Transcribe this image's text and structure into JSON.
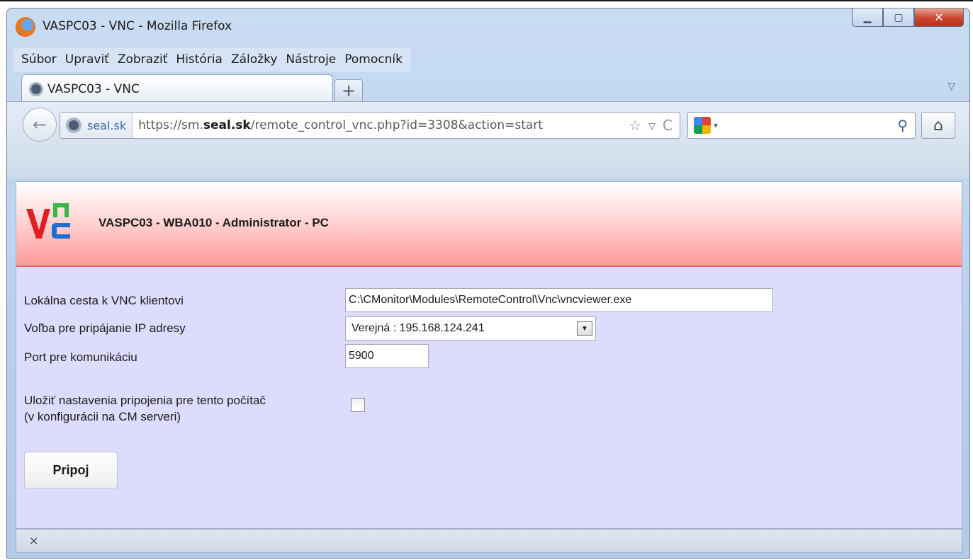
{
  "window": {
    "title": "VASPC03 - VNC - Mozilla Firefox",
    "minimize_glyph": "▁",
    "maximize_glyph": "▢",
    "close_glyph": "✕"
  },
  "menu": [
    "Súbor",
    "Upraviť",
    "Zobraziť",
    "História",
    "Záložky",
    "Nástroje",
    "Pomocník"
  ],
  "tab": {
    "label": "VASPC03 - VNC",
    "new_tab_glyph": "+",
    "list_glyph": "▽"
  },
  "navbar": {
    "back_glyph": "←",
    "site_identity": "seal.sk",
    "url_prefix": "https://sm.",
    "url_domain": "seal.sk",
    "url_suffix": "/remote_control_vnc.php?id=3308&action=start",
    "star_glyph": "☆",
    "dropdown_glyph": "▿",
    "reload_glyph": "C",
    "search_dropdown_glyph": "▾",
    "search_glyph": "⚲",
    "home_glyph": "⌂"
  },
  "page": {
    "heading": "VASPC03 - WBA010 - Administrator - PC",
    "fields": {
      "client_path_label": "Lokálna cesta k VNC klientovi",
      "client_path_value": "C:\\CMonitor\\Modules\\RemoteControl\\Vnc\\vncviewer.exe",
      "ip_choice_label": "Voľba pre pripájanie IP adresy",
      "ip_choice_value": "Verejná : 195.168.124.241",
      "port_label": "Port pre komunikáciu",
      "port_value": "5900",
      "save_label_line1": "Uložiť nastavenia pripojenia pre tento počítač",
      "save_label_line2": "(v konfigurácii na CM serveri)",
      "save_checked": false
    },
    "connect_button": "Pripoj"
  },
  "statusbar": {
    "close_glyph": "×"
  },
  "colors": {
    "banner_top": "#ffffff",
    "banner_bottom": "#ff9a9a",
    "content_bg": "#dedcfc",
    "vnc_red": "#e02020",
    "vnc_green": "#39b54a",
    "vnc_blue": "#1f6fd1"
  }
}
